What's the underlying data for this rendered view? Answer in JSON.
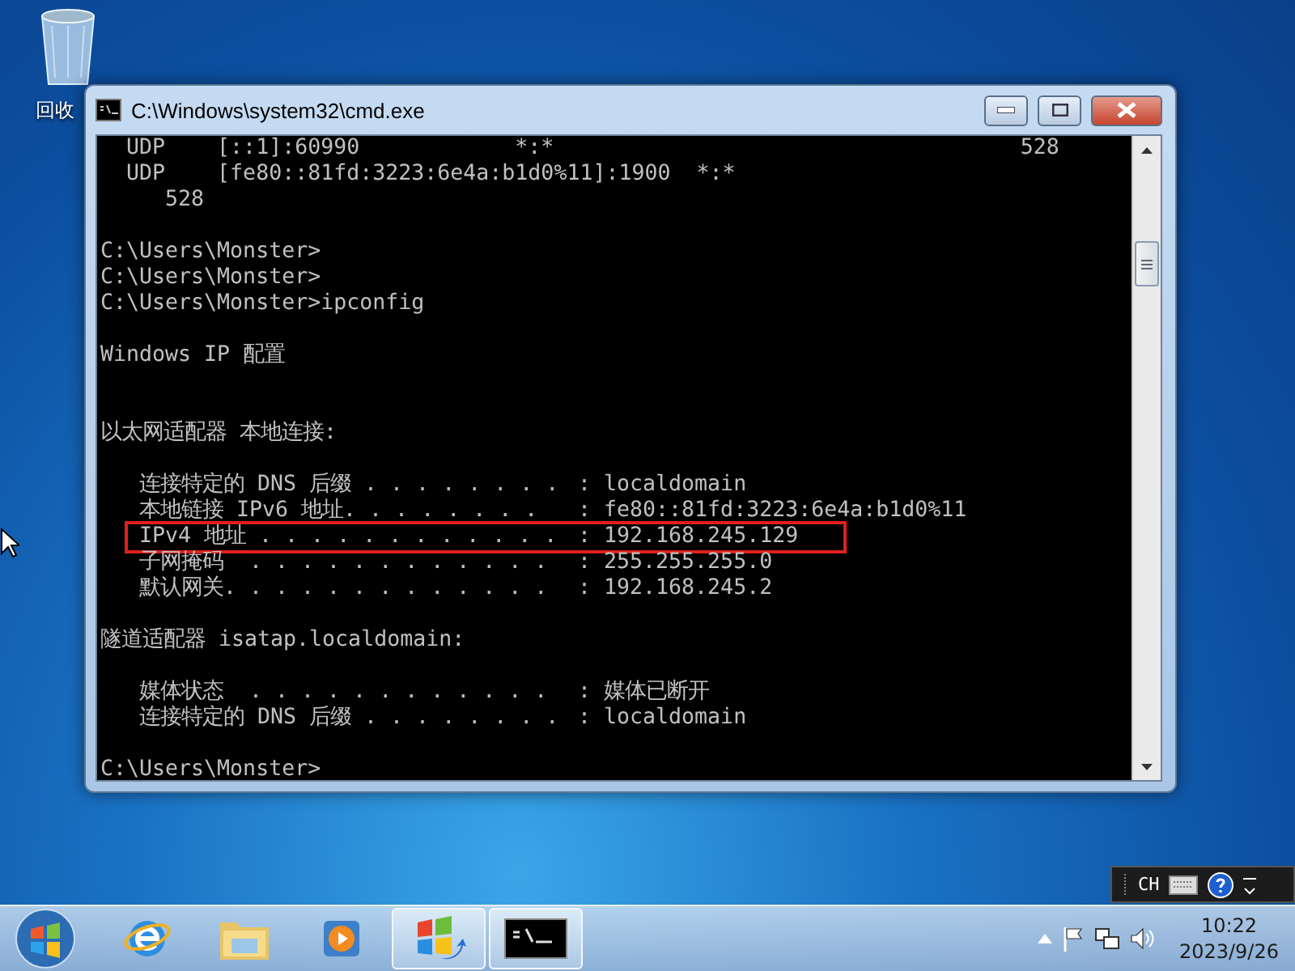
{
  "desktop": {
    "icons": [
      {
        "kind": "recycle_bin",
        "label": "回收"
      }
    ]
  },
  "window": {
    "title": "C:\\Windows\\system32\\cmd.exe",
    "console_lines": [
      {
        "kind": "text",
        "text": "  UDP    [::1]:60990            *:*                                    528"
      },
      {
        "kind": "text",
        "text": "  UDP    [fe80::81fd:3223:6e4a:b1d0%11]:1900  *:*"
      },
      {
        "kind": "text",
        "text": "     528"
      },
      {
        "kind": "blank"
      },
      {
        "kind": "text",
        "text": "C:\\Users\\Monster>"
      },
      {
        "kind": "text",
        "text": "C:\\Users\\Monster>"
      },
      {
        "kind": "text",
        "text": "C:\\Users\\Monster>ipconfig"
      },
      {
        "kind": "blank"
      },
      {
        "kind": "text",
        "text": "Windows IP 配置"
      },
      {
        "kind": "blank"
      },
      {
        "kind": "blank"
      },
      {
        "kind": "text",
        "text": "以太网适配器 本地连接:"
      },
      {
        "kind": "blank"
      },
      {
        "kind": "field",
        "label": "连接特定的 DNS 后缀 . . . . . . . .",
        "value": ": localdomain",
        "highlighted": false
      },
      {
        "kind": "field",
        "label": "本地链接 IPv6 地址. . . . . . . .",
        "value": ": fe80::81fd:3223:6e4a:b1d0%11",
        "highlighted": false
      },
      {
        "kind": "field",
        "label": "IPv4 地址 . . . . . . . . . . . .",
        "value": ": 192.168.245.129",
        "highlighted": true
      },
      {
        "kind": "field",
        "label": "子网掩码  . . . . . . . . . . . .",
        "value": ": 255.255.255.0",
        "highlighted": false
      },
      {
        "kind": "field",
        "label": "默认网关. . . . . . . . . . . . .",
        "value": ": 192.168.245.2",
        "highlighted": false
      },
      {
        "kind": "blank"
      },
      {
        "kind": "text",
        "text": "隧道适配器 isatap.localdomain:"
      },
      {
        "kind": "blank"
      },
      {
        "kind": "field",
        "label": "媒体状态  . . . . . . . . . . . .",
        "value": ": 媒体已断开",
        "highlighted": false
      },
      {
        "kind": "field",
        "label": "连接特定的 DNS 后缀 . . . . . . . .",
        "value": ": localdomain",
        "highlighted": false
      },
      {
        "kind": "blank"
      },
      {
        "kind": "text",
        "text": "C:\\Users\\Monster>"
      }
    ]
  },
  "language_bar": {
    "language": "CH"
  },
  "taskbar": {
    "apps": [
      {
        "kind": "browser",
        "running": false
      },
      {
        "kind": "folder",
        "running": false
      },
      {
        "kind": "media",
        "running": false
      },
      {
        "kind": "windows",
        "running": true
      },
      {
        "kind": "console",
        "running": true
      }
    ],
    "clock": {
      "time": "10:22",
      "date": "2023/9/26"
    }
  }
}
